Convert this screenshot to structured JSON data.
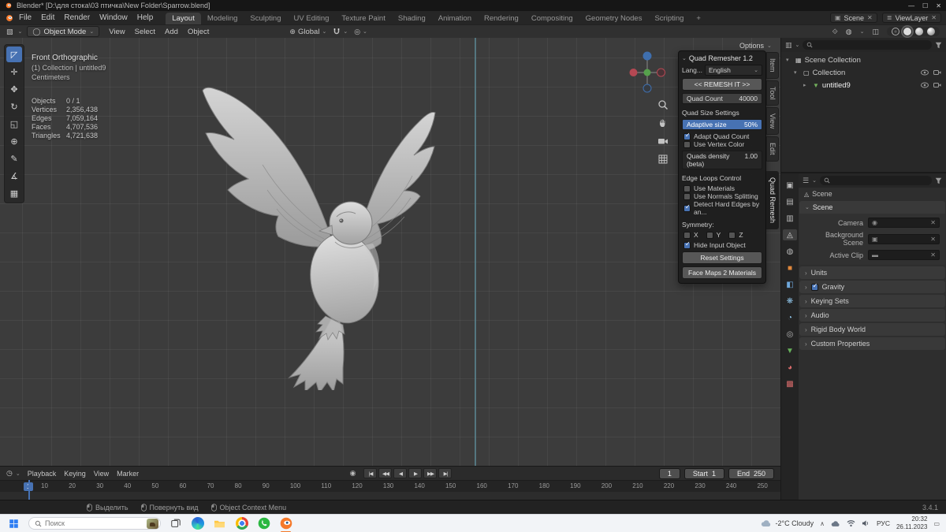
{
  "titlebar": {
    "title": "Blender* [D:\\для стока\\03 птичка\\New Folder\\Sparrow.blend]"
  },
  "menubar": {
    "menus": [
      "File",
      "Edit",
      "Render",
      "Window",
      "Help"
    ],
    "workspaces": [
      {
        "label": "Layout",
        "active": true
      },
      {
        "label": "Modeling"
      },
      {
        "label": "Sculpting"
      },
      {
        "label": "UV Editing"
      },
      {
        "label": "Texture Paint"
      },
      {
        "label": "Shading"
      },
      {
        "label": "Animation"
      },
      {
        "label": "Rendering"
      },
      {
        "label": "Compositing"
      },
      {
        "label": "Geometry Nodes"
      },
      {
        "label": "Scripting"
      },
      {
        "label": "+"
      }
    ],
    "scene_label": "Scene",
    "viewlayer_label": "ViewLayer"
  },
  "toolheader": {
    "mode": "Object Mode",
    "menus": [
      "View",
      "Select",
      "Add",
      "Object"
    ],
    "orientation": "Global",
    "options_label": "Options"
  },
  "toolbar": {
    "tools": [
      {
        "name": "tweak-select",
        "glyph": "◸",
        "active": true
      },
      {
        "name": "cursor",
        "glyph": "✛"
      },
      {
        "name": "move",
        "glyph": "✥"
      },
      {
        "name": "rotate",
        "glyph": "↻"
      },
      {
        "name": "scale",
        "glyph": "◱"
      },
      {
        "name": "transform",
        "glyph": "⊕"
      },
      {
        "name": "annotate",
        "glyph": "✎"
      },
      {
        "name": "measure",
        "glyph": "∡"
      },
      {
        "name": "add-cube",
        "glyph": "▦"
      }
    ]
  },
  "viewport": {
    "view_label": "Front Orthographic",
    "collection_label": "(1) Collection | untitled9",
    "units_label": "Centimeters",
    "stats": [
      {
        "name": "Objects",
        "value": "0 / 1"
      },
      {
        "name": "Vertices",
        "value": "2,356,438"
      },
      {
        "name": "Edges",
        "value": "7,059,164"
      },
      {
        "name": "Faces",
        "value": "4,707,536"
      },
      {
        "name": "Triangles",
        "value": "4,721,638"
      }
    ]
  },
  "sidebar_tabs": [
    {
      "label": "Item"
    },
    {
      "label": "Tool"
    },
    {
      "label": "View"
    },
    {
      "label": "Edit"
    },
    {
      "label": "Quad Remesh",
      "active": true
    }
  ],
  "quad_panel": {
    "title": "Quad Remesher 1.2",
    "lang_label": "Lang...",
    "lang_value": "English",
    "remesh_button": "<< REMESH IT >>",
    "quad_count_label": "Quad Count",
    "quad_count_value": "40000",
    "size_settings_label": "Quad Size Settings",
    "adaptive_label": "Adaptive size",
    "adaptive_value": "50%",
    "checks1": [
      {
        "label": "Adapt Quad Count",
        "checked": true
      },
      {
        "label": "Use Vertex Color"
      }
    ],
    "density_label": "Quads density (beta)",
    "density_value": "1.00",
    "edge_loops_label": "Edge Loops Control",
    "checks2": [
      {
        "label": "Use Materials"
      },
      {
        "label": "Use Normals Splitting"
      },
      {
        "label": "Detect Hard Edges by an...",
        "checked": true
      }
    ],
    "symmetry_label": "Symmetry:",
    "axes": [
      {
        "label": "X"
      },
      {
        "label": "Y"
      },
      {
        "label": "Z"
      }
    ],
    "hide_input_label": "Hide Input Object",
    "reset_button": "Reset Settings",
    "facemaps_button": "Face Maps 2 Materials"
  },
  "outliner": {
    "rows": [
      {
        "label": "Scene Collection"
      },
      {
        "label": "Collection"
      },
      {
        "label": "untitled9"
      }
    ]
  },
  "properties": {
    "breadcrumb": "Scene",
    "section": "Scene",
    "fields": [
      {
        "label": "Camera",
        "glyph": "◉"
      },
      {
        "label": "Background Scene",
        "glyph": "▣"
      },
      {
        "label": "Active Clip",
        "glyph": "▬"
      }
    ],
    "sections": [
      {
        "label": "Units"
      },
      {
        "label": "Gravity",
        "has_checkbox": true
      },
      {
        "label": "Keying Sets"
      },
      {
        "label": "Audio"
      },
      {
        "label": "Rigid Body World"
      },
      {
        "label": "Custom Properties"
      }
    ],
    "tabs": [
      {
        "name": "render",
        "glyph": "▣",
        "color": "#b9b9b9"
      },
      {
        "name": "output",
        "glyph": "▤",
        "color": "#b9b9b9"
      },
      {
        "name": "view-layer",
        "glyph": "▥",
        "color": "#b9b9b9"
      },
      {
        "name": "scene",
        "glyph": "◬",
        "color": "#d9d9d9",
        "active": true
      },
      {
        "name": "world",
        "glyph": "◍",
        "color": "#b9b9b9"
      },
      {
        "name": "object",
        "glyph": "■",
        "color": "#e0883c"
      },
      {
        "name": "modifiers",
        "glyph": "◧",
        "color": "#6fa8dc"
      },
      {
        "name": "particles",
        "glyph": "❋",
        "color": "#8fc4e8"
      },
      {
        "name": "physics",
        "glyph": "◔",
        "color": "#8fc4e8"
      },
      {
        "name": "constraints",
        "glyph": "◎",
        "color": "#b9b9b9"
      },
      {
        "name": "object-data",
        "glyph": "▼",
        "color": "#66b05a"
      },
      {
        "name": "material",
        "glyph": "◕",
        "color": "#d66a6a"
      },
      {
        "name": "texture",
        "glyph": "▩",
        "color": "#d66a6a"
      }
    ]
  },
  "timeline": {
    "menus": [
      "Playback",
      "Keying",
      "View",
      "Marker"
    ],
    "transport": [
      "|◀",
      "◀◀",
      "◀",
      "▶",
      "▶▶",
      "▶|"
    ],
    "current_frame": "1",
    "start_label": "Start",
    "start_value": "1",
    "end_label": "End",
    "end_value": "250",
    "ruler": [
      "10",
      "20",
      "30",
      "40",
      "50",
      "60",
      "70",
      "80",
      "90",
      "100",
      "110",
      "120",
      "130",
      "140",
      "150",
      "160",
      "170",
      "180",
      "190",
      "200",
      "210",
      "220",
      "230",
      "240",
      "250"
    ]
  },
  "statusbar": {
    "hints": [
      {
        "label": "Выделить"
      },
      {
        "label": "Повернуть вид"
      },
      {
        "label": "Object Context Menu"
      }
    ],
    "version": "3.4.1"
  },
  "taskbar": {
    "search_placeholder": "Поиск",
    "weather": "-2°C Cloudy",
    "lang": "РУС",
    "time": "20:32",
    "date": "26.11.2023"
  },
  "colors": {
    "accent": "#4772b3",
    "viewport_bg": "#3c3c3c",
    "panel_bg": "#2e2e2e"
  }
}
